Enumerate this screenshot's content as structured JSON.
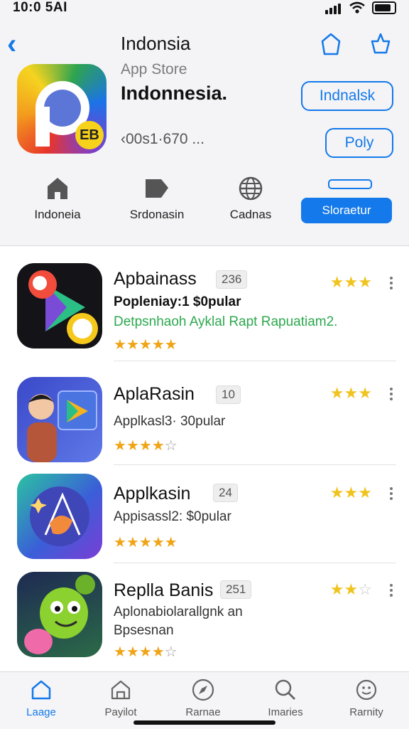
{
  "status": {
    "time": "10:0 5AI"
  },
  "nav": {
    "title": "Indonsia"
  },
  "app": {
    "subtitle": "App Store",
    "name": "Indonnesia.",
    "meta": "‹00s1·670 ...",
    "badge": "EB",
    "button_primary": "Indnalsk",
    "button_secondary": "Poly"
  },
  "categories": [
    {
      "label": "Indoneia",
      "icon": "house-icon"
    },
    {
      "label": "Srdonasin",
      "icon": "tag-icon"
    },
    {
      "label": "Cadnas",
      "icon": "globe-icon"
    },
    {
      "label": "Sloraetur",
      "icon": "toggle-icon",
      "active": true
    }
  ],
  "apps": [
    {
      "name": "Apbainass",
      "count": "236",
      "line1": "Popleniay:1  $0pular",
      "line2": "Detpsnhaoh Ayklal Rapt Rapuatiam2.",
      "rating_left": 4.5,
      "rating_right": 2.5
    },
    {
      "name": "AplaRasin",
      "count": "10",
      "line1": "Applkasl3· 30pular",
      "line2": "",
      "rating_left": 3.5,
      "rating_right": 2.5
    },
    {
      "name": "Applkasin",
      "count": "24",
      "line1": "Appisassl2: $0pular",
      "line2": "",
      "rating_left": 4.5,
      "rating_right": 2.5
    },
    {
      "name": "Replla Banis",
      "count": "251",
      "line1": "Aplonabiolarallgnk an",
      "line2": "Bpsesnan",
      "rating_left": 3.5,
      "rating_right": 1.5
    }
  ],
  "tabs": [
    {
      "label": "Laage",
      "icon": "home-icon",
      "active": true
    },
    {
      "label": "Payilot",
      "icon": "store-icon"
    },
    {
      "label": "Rarnae",
      "icon": "compass-icon"
    },
    {
      "label": "Imaries",
      "icon": "search-icon"
    },
    {
      "label": "Rarnity",
      "icon": "face-icon"
    }
  ],
  "colors": {
    "accent": "#1479ea",
    "star": "#f0a416",
    "green_text": "#2ca84e"
  }
}
